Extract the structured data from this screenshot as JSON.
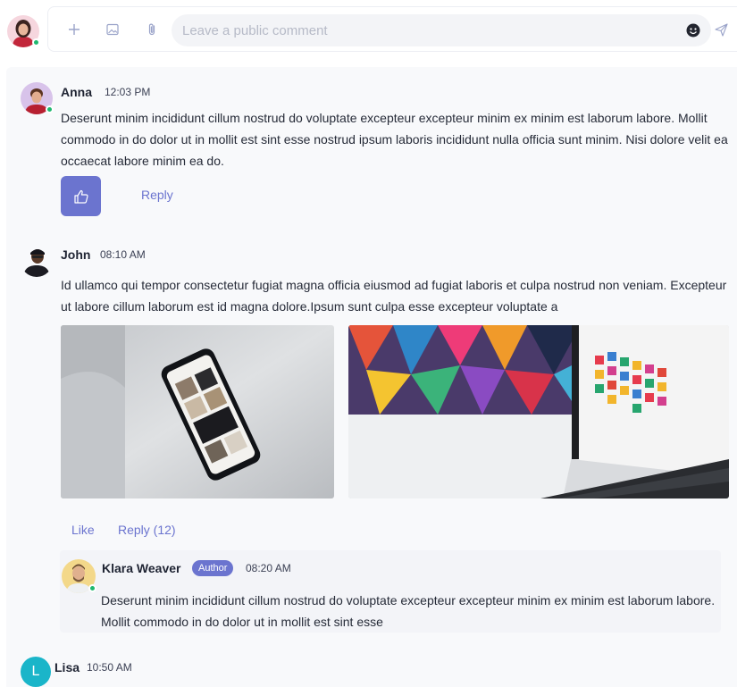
{
  "composer": {
    "placeholder": "Leave a public comment",
    "icons": [
      "plus-icon",
      "image-icon",
      "paperclip-icon",
      "emoji-icon",
      "send-icon"
    ]
  },
  "comments": [
    {
      "author": "Anna",
      "time": "12:03 PM",
      "text": "Deserunt minim incididunt cillum nostrud do voluptate excepteur excepteur minim ex minim est laborum labore. Mollit commodo in do dolor ut in mollit est sint esse nostrud ipsum laboris incididunt nulla officia sunt minim. Nisi dolore velit ea occaecat labore minim ea do.",
      "reply_label": "Reply"
    },
    {
      "author": "John",
      "time": "08:10 AM",
      "text": "Id ullamco qui tempor consectetur fugiat magna officia eiusmod ad fugiat laboris et culpa nostrud non veniam. Excepteur ut labore cillum laborum est id magna dolore.Ipsum sunt culpa esse excepteur voluptate a",
      "like_label": "Like",
      "reply_label": "Reply (12)",
      "reply": {
        "author": "Klara Weaver",
        "badge": "Author",
        "time": "08:20 AM",
        "text": "Deserunt minim incididunt cillum nostrud do voluptate excepteur excepteur minim ex minim est laborum labore. Mollit commodo in do dolor ut in mollit est sint esse"
      }
    },
    {
      "author": "Lisa",
      "time": "10:50 AM",
      "avatar_letter": "L"
    }
  ],
  "colors": {
    "accent": "#6b74cf",
    "online": "#1fb86f",
    "feed_bg": "#f8f9fb"
  }
}
